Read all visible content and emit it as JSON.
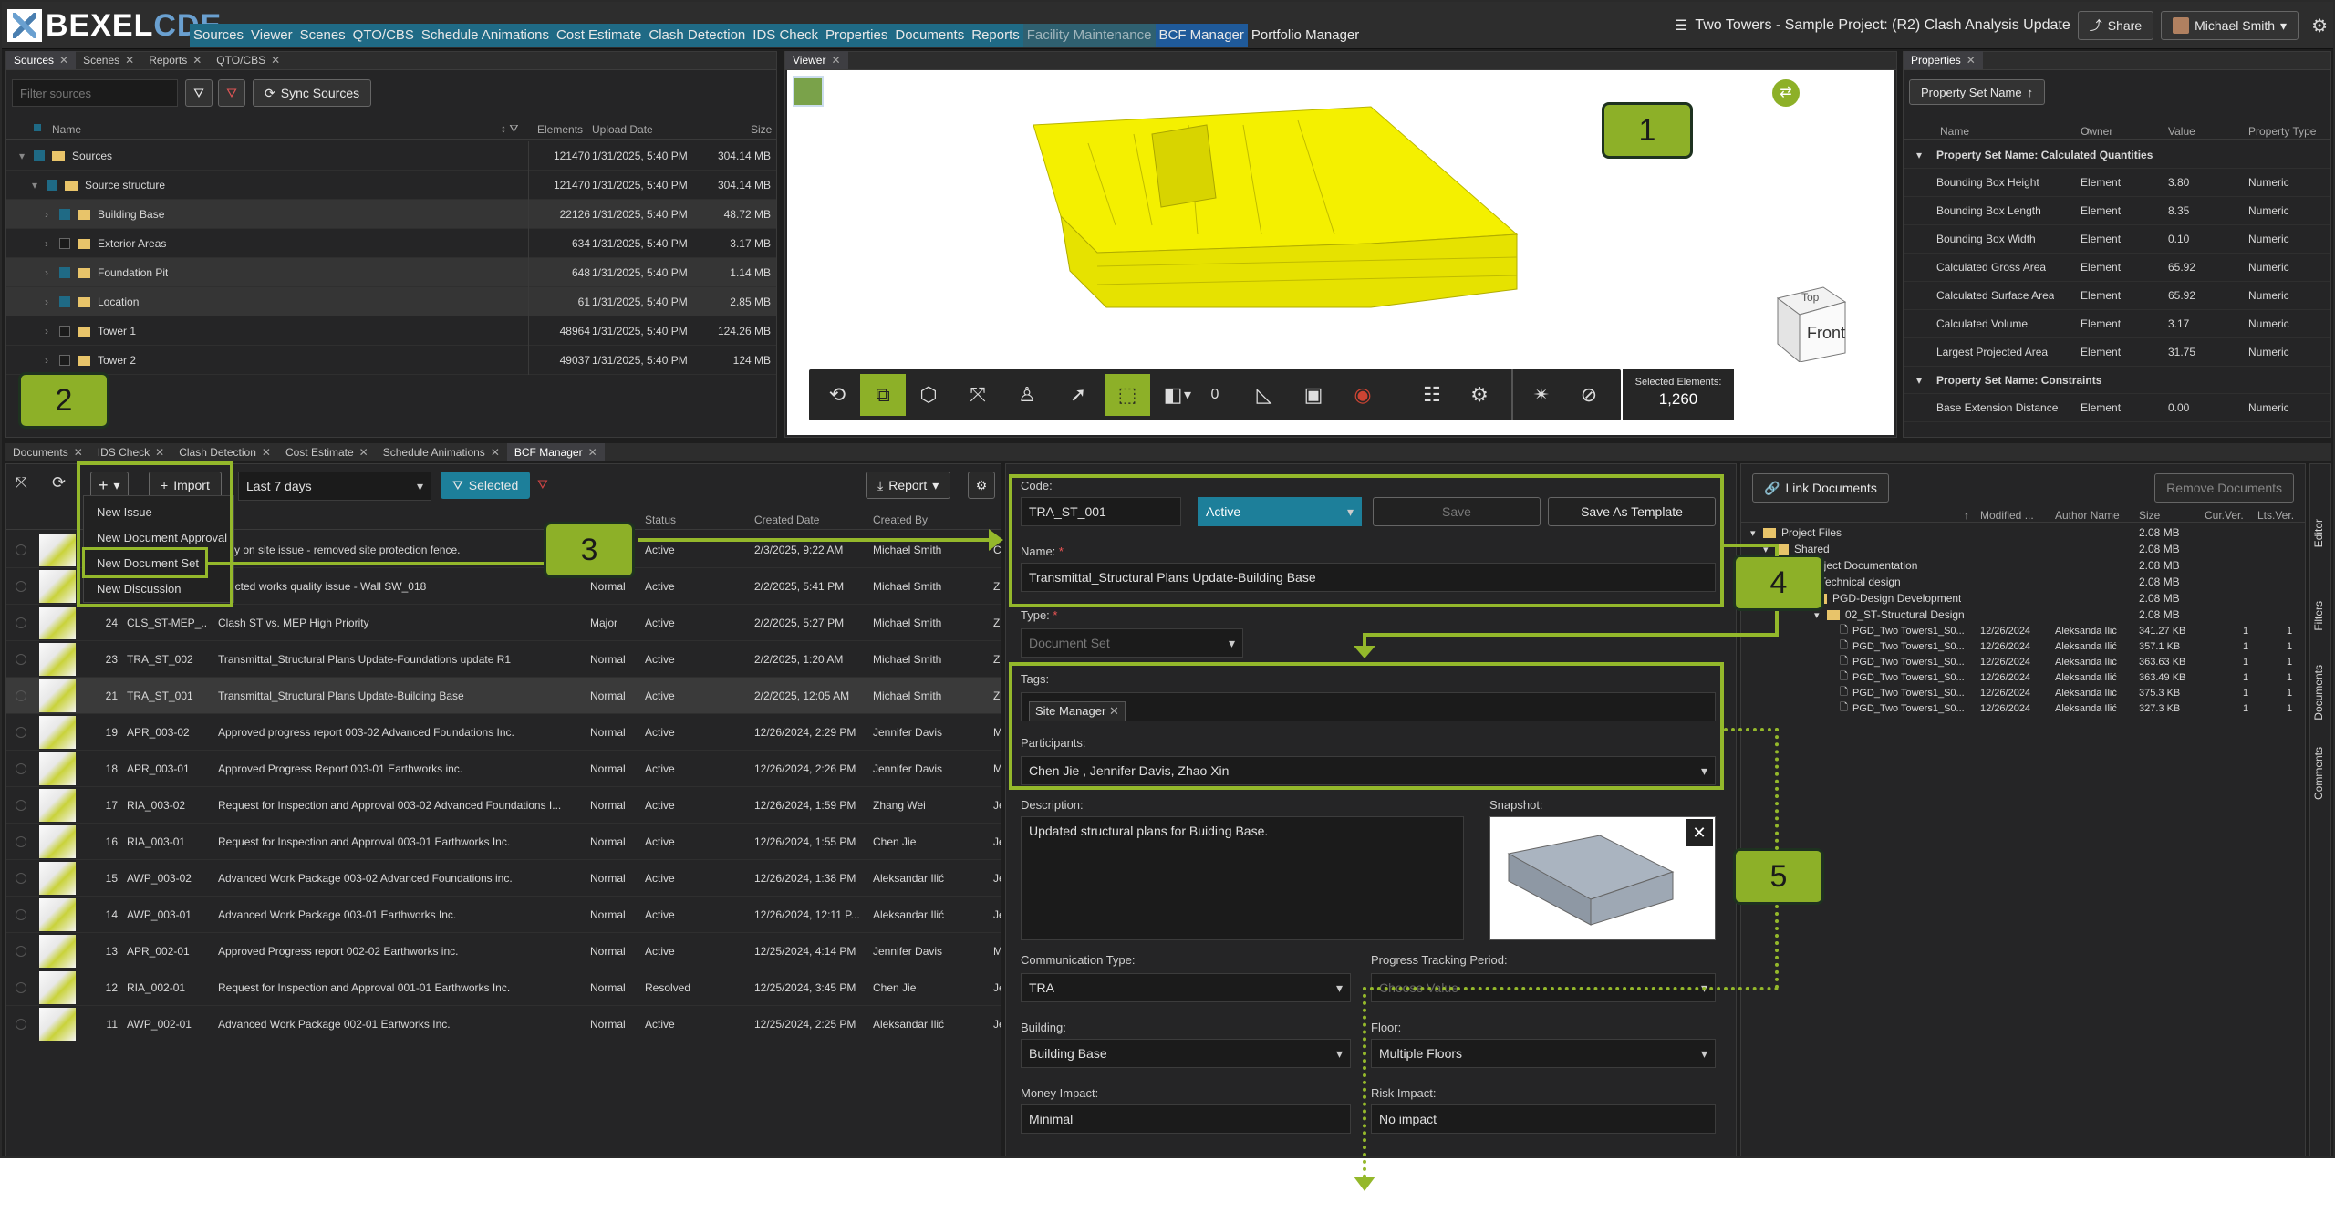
{
  "app": {
    "logo_a": "BEXEL",
    "logo_b": "CDE",
    "project": "Two Towers - Sample Project: (R2) Clash Analysis Update",
    "share": "Share",
    "user": "Michael Smith"
  },
  "menu": [
    "Sources",
    "Viewer",
    "Scenes",
    "QTO/CBS",
    "Schedule Animations",
    "Cost Estimate",
    "Clash Detection",
    "IDS Check",
    "Properties",
    "Documents",
    "Reports",
    "Facility Maintenance",
    "BCF Manager",
    "Portfolio Manager"
  ],
  "sources": {
    "tabs": [
      "Sources",
      "Scenes",
      "Reports",
      "QTO/CBS"
    ],
    "filter_placeholder": "Filter sources",
    "sync": "Sync Sources",
    "headers": [
      "Name",
      "Elements",
      "Upload Date",
      "Size"
    ],
    "rows": [
      {
        "name": "Sources",
        "el": "121470",
        "date": "1/31/2025, 5:40 PM",
        "size": "304.14 MB"
      },
      {
        "name": "Source structure",
        "el": "121470",
        "date": "1/31/2025, 5:40 PM",
        "size": "304.14 MB"
      },
      {
        "name": "Building Base",
        "el": "22126",
        "date": "1/31/2025, 5:40 PM",
        "size": "48.72 MB"
      },
      {
        "name": "Exterior Areas",
        "el": "634",
        "date": "1/31/2025, 5:40 PM",
        "size": "3.17 MB"
      },
      {
        "name": "Foundation Pit",
        "el": "648",
        "date": "1/31/2025, 5:40 PM",
        "size": "1.14 MB"
      },
      {
        "name": "Location",
        "el": "61",
        "date": "1/31/2025, 5:40 PM",
        "size": "2.85 MB"
      },
      {
        "name": "Tower 1",
        "el": "48964",
        "date": "1/31/2025, 5:40 PM",
        "size": "124.26 MB"
      },
      {
        "name": "Tower 2",
        "el": "49037",
        "date": "1/31/2025, 5:40 PM",
        "size": "124 MB"
      }
    ]
  },
  "viewer": {
    "tab": "Viewer",
    "count": "0",
    "selected_label": "Selected Elements:",
    "selected_value": "1,260",
    "cube_top": "Top",
    "cube_front": "Front"
  },
  "properties": {
    "tab": "Properties",
    "group_by": "Property Set Name",
    "headers": [
      "Name",
      "Owner",
      "Value",
      "Property Type"
    ],
    "group1": "Property Set Name: Calculated Quantities",
    "rows": [
      {
        "n": "Bounding Box Height",
        "o": "Element",
        "v": "3.80",
        "t": "Numeric"
      },
      {
        "n": "Bounding Box Length",
        "o": "Element",
        "v": "8.35",
        "t": "Numeric"
      },
      {
        "n": "Bounding Box Width",
        "o": "Element",
        "v": "0.10",
        "t": "Numeric"
      },
      {
        "n": "Calculated Gross Area",
        "o": "Element",
        "v": "65.92",
        "t": "Numeric"
      },
      {
        "n": "Calculated Surface Area",
        "o": "Element",
        "v": "65.92",
        "t": "Numeric"
      },
      {
        "n": "Calculated Volume",
        "o": "Element",
        "v": "3.17",
        "t": "Numeric"
      },
      {
        "n": "Largest Projected Area",
        "o": "Element",
        "v": "31.75",
        "t": "Numeric"
      }
    ],
    "group2": "Property Set Name: Constraints",
    "rows2": [
      {
        "n": "Base Extension Distance",
        "o": "Element",
        "v": "0.00",
        "t": "Numeric"
      }
    ]
  },
  "bottom_tabs": [
    "Documents",
    "IDS Check",
    "Clash Detection",
    "Cost Estimate",
    "Schedule Animations",
    "BCF Manager"
  ],
  "bcf": {
    "import": "Import",
    "period": "Last 7 days",
    "selected": "Selected",
    "report": "Report",
    "new_menu": [
      "New Issue",
      "New Document Approval",
      "New Document Set",
      "New Discussion"
    ],
    "headers": [
      "Status",
      "Created Date",
      "Created By"
    ],
    "rows": [
      {
        "id": "",
        "code": "",
        "title": "…ity on site issue - removed site protection fence.",
        "pri": "",
        "status": "Active",
        "date": "2/3/2025, 9:22 AM",
        "by": "Michael Smith",
        "c": "C"
      },
      {
        "id": "",
        "code": "",
        "title": "…ucted works quality issue - Wall SW_018",
        "pri": "Normal",
        "status": "Active",
        "date": "2/2/2025, 5:41 PM",
        "by": "Michael Smith",
        "c": "Z"
      },
      {
        "id": "24",
        "code": "CLS_ST-MEP_...",
        "title": "Clash ST vs. MEP High Priority",
        "pri": "Major",
        "status": "Active",
        "date": "2/2/2025, 5:27 PM",
        "by": "Michael Smith",
        "c": "Z"
      },
      {
        "id": "23",
        "code": "TRA_ST_002",
        "title": "Transmittal_Structural Plans Update-Foundations update R1",
        "pri": "Normal",
        "status": "Active",
        "date": "2/2/2025, 1:20 AM",
        "by": "Michael Smith",
        "c": "Z"
      },
      {
        "id": "21",
        "code": "TRA_ST_001",
        "title": "Transmittal_Structural Plans Update-Building Base",
        "pri": "Normal",
        "status": "Active",
        "date": "2/2/2025, 12:05 AM",
        "by": "Michael Smith",
        "c": "Z"
      },
      {
        "id": "19",
        "code": "APR_003-02",
        "title": "Approved progress report 003-02 Advanced Foundations Inc.",
        "pri": "Normal",
        "status": "Active",
        "date": "12/26/2024, 2:29 PM",
        "by": "Jennifer Davis",
        "c": "M"
      },
      {
        "id": "18",
        "code": "APR_003-01",
        "title": "Approved Progress Report 003-01 Earthworks inc.",
        "pri": "Normal",
        "status": "Active",
        "date": "12/26/2024, 2:26 PM",
        "by": "Jennifer Davis",
        "c": "M"
      },
      {
        "id": "17",
        "code": "RIA_003-02",
        "title": "Request for Inspection and Approval 003-02 Advanced Foundations I...",
        "pri": "Normal",
        "status": "Active",
        "date": "12/26/2024, 1:59 PM",
        "by": "Zhang Wei",
        "c": "Je"
      },
      {
        "id": "16",
        "code": "RIA_003-01",
        "title": "Request for Inspection and Approval 003-01 Earthworks Inc.",
        "pri": "Normal",
        "status": "Active",
        "date": "12/26/2024, 1:55 PM",
        "by": "Chen Jie",
        "c": "Je"
      },
      {
        "id": "15",
        "code": "AWP_003-02",
        "title": "Advanced Work Package 003-02 Advanced Foundations inc.",
        "pri": "Normal",
        "status": "Active",
        "date": "12/26/2024, 1:38 PM",
        "by": "Aleksandar Ilić",
        "c": "Je"
      },
      {
        "id": "14",
        "code": "AWP_003-01",
        "title": "Advanced Work Package 003-01 Earthworks Inc.",
        "pri": "Normal",
        "status": "Active",
        "date": "12/26/2024, 12:11 P...",
        "by": "Aleksandar Ilić",
        "c": "Je"
      },
      {
        "id": "13",
        "code": "APR_002-01",
        "title": "Approved Progress report 002-02 Earthworks inc.",
        "pri": "Normal",
        "status": "Active",
        "date": "12/25/2024, 4:14 PM",
        "by": "Jennifer Davis",
        "c": "M"
      },
      {
        "id": "12",
        "code": "RIA_002-01",
        "title": "Request for Inspection and Approval 001-01 Earthworks Inc.",
        "pri": "Normal",
        "status": "Resolved",
        "date": "12/25/2024, 3:45 PM",
        "by": "Chen Jie",
        "c": "Je"
      },
      {
        "id": "11",
        "code": "AWP_002-01",
        "title": "Advanced Work Package 002-01 Eartworks Inc.",
        "pri": "Normal",
        "status": "Active",
        "date": "12/25/2024, 2:25 PM",
        "by": "Aleksandar Ilić",
        "c": "Je"
      }
    ]
  },
  "form": {
    "code_label": "Code:",
    "code": "TRA_ST_001",
    "status": "Active",
    "save": "Save",
    "save_template": "Save As Template",
    "name_label": "Name:",
    "name": "Transmittal_Structural Plans Update-Building Base",
    "type_label": "Type:",
    "type": "Document Set",
    "tags_label": "Tags:",
    "tag": "Site Manager",
    "participants_label": "Participants:",
    "participants": "Chen  Jie , Jennifer Davis, Zhao  Xin",
    "desc_label": "Description:",
    "desc": "Updated structural plans for Buiding Base.",
    "snapshot_label": "Snapshot:",
    "comm_label": "Communication Type:",
    "comm": "TRA",
    "progress_label": "Progress Tracking Period:",
    "progress_placeholder": "Choose Value",
    "building_label": "Building:",
    "building": "Building Base",
    "floor_label": "Floor:",
    "floor": "Multiple Floors",
    "money_label": "Money Impact:",
    "money": "Minimal",
    "risk_label": "Risk Impact:",
    "risk": "No impact"
  },
  "docs": {
    "link": "Link Documents",
    "remove": "Remove Documents",
    "headers": [
      "Modified ...",
      "Author Name",
      "Size",
      "Cur.Ver.",
      "Lts.Ver."
    ],
    "tree": [
      {
        "name": "Project Files",
        "size": "2.08 MB",
        "indent": 0
      },
      {
        "name": "Shared",
        "size": "2.08 MB",
        "indent": 1
      },
      {
        "name": "Project Documentation",
        "size": "2.08 MB",
        "indent": 2
      },
      {
        "name": "Technical design",
        "size": "2.08 MB",
        "indent": 3
      },
      {
        "name": "PGD-Design Development",
        "size": "2.08 MB",
        "indent": 4
      },
      {
        "name": "02_ST-Structural Design",
        "size": "2.08 MB",
        "indent": 5
      }
    ],
    "files": [
      {
        "name": "PGD_Two Towers1_S0...",
        "mod": "12/26/2024",
        "author": "Aleksanda Ilić",
        "size": "341.27 KB",
        "cur": "1",
        "lts": "1"
      },
      {
        "name": "PGD_Two Towers1_S0...",
        "mod": "12/26/2024",
        "author": "Aleksanda Ilić",
        "size": "357.1 KB",
        "cur": "1",
        "lts": "1"
      },
      {
        "name": "PGD_Two Towers1_S0...",
        "mod": "12/26/2024",
        "author": "Aleksanda Ilić",
        "size": "363.63 KB",
        "cur": "1",
        "lts": "1"
      },
      {
        "name": "PGD_Two Towers1_S0...",
        "mod": "12/26/2024",
        "author": "Aleksanda Ilić",
        "size": "363.49 KB",
        "cur": "1",
        "lts": "1"
      },
      {
        "name": "PGD_Two Towers1_S0...",
        "mod": "12/26/2024",
        "author": "Aleksanda Ilić",
        "size": "375.3 KB",
        "cur": "1",
        "lts": "1"
      },
      {
        "name": "PGD_Two Towers1_S0...",
        "mod": "12/26/2024",
        "author": "Aleksanda Ilić",
        "size": "327.3 KB",
        "cur": "1",
        "lts": "1"
      }
    ],
    "side_tabs": [
      "Editor",
      "Filters",
      "Documents",
      "Comments"
    ]
  },
  "callouts": [
    "1",
    "2",
    "3",
    "4",
    "5"
  ]
}
